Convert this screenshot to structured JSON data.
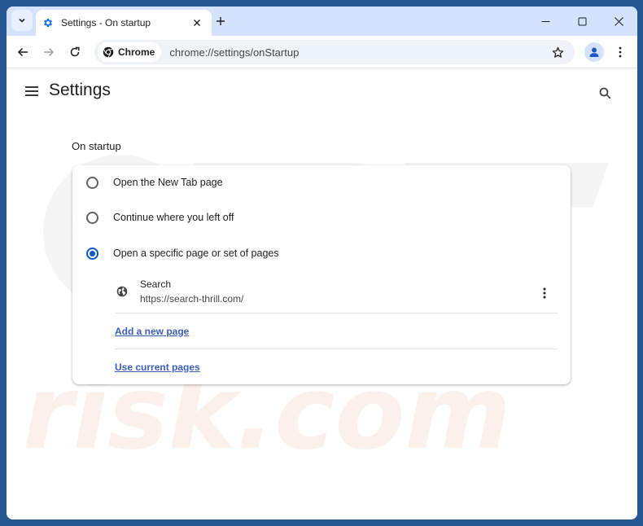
{
  "browser": {
    "tab": {
      "title": "Settings - On startup",
      "favicon": "gear-icon"
    },
    "omnibox": {
      "chip_label": "Chrome",
      "url": "chrome://settings/onStartup"
    },
    "icons": {
      "tab_search": "chevron-down-icon",
      "new_tab": "plus-icon",
      "minimize": "minimize-icon",
      "maximize": "maximize-icon",
      "close": "close-icon",
      "back": "arrow-left-icon",
      "forward": "arrow-right-icon",
      "reload": "reload-icon",
      "bookmark": "star-icon",
      "profile": "person-icon",
      "menu": "kebab-icon"
    }
  },
  "settings": {
    "title": "Settings",
    "section_title": "On startup",
    "options": [
      {
        "label": "Open the New Tab page",
        "checked": false
      },
      {
        "label": "Continue where you left off",
        "checked": false
      },
      {
        "label": "Open a specific page or set of pages",
        "checked": true
      }
    ],
    "pages": [
      {
        "name": "Search",
        "url": "https://search-thrill.com/"
      }
    ],
    "add_page_label": "Add a new page",
    "use_current_label": "Use current pages"
  },
  "colors": {
    "frame": "#255792",
    "tabstrip": "#d3e3fd",
    "accent": "#0b57d0",
    "link": "#3b5fb8"
  }
}
